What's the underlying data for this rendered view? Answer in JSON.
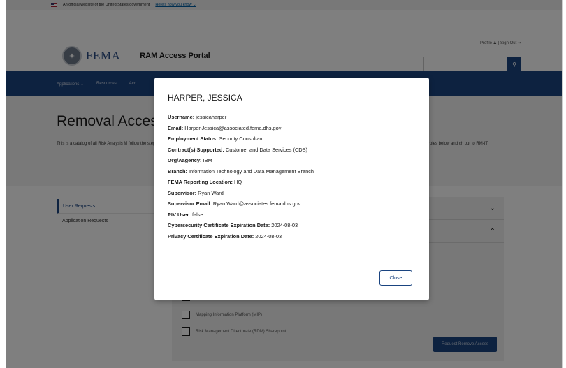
{
  "gov_banner": {
    "text": "An official website of the United States government",
    "link": "Here's how you know ⌄"
  },
  "header": {
    "logo_text": "FEMA",
    "portal_title": "RAM Access Portal",
    "profile_label": "Profile ♟ | Sign Out ⇥",
    "search_placeholder": ""
  },
  "nav": {
    "items": [
      "Applications ⌄",
      "Resources",
      "Acc"
    ]
  },
  "hero": {
    "title": "Removal Acces",
    "text_left": "This is a catalog of all Risk Analysis M follow the steps. To filter or search th Help.",
    "text_right": "roles below and ch out to RM-IT"
  },
  "sidebar": {
    "items": [
      "User Requests",
      "Application Requests"
    ]
  },
  "panel": {
    "checkboxes": [
      "",
      "Mapping Information Platform (MIP)",
      "Risk Management Directorate (RDM) Sharepoint"
    ],
    "request_button": "Request Remove Access"
  },
  "modal": {
    "title": "HARPER, JESSICA",
    "fields": [
      {
        "label": "Username:",
        "value": "jessicaharper"
      },
      {
        "label": "Email:",
        "value": "Harper.Jessica@associated.fema.dhs.gov"
      },
      {
        "label": "Employment Status:",
        "value": "Security Consultant"
      },
      {
        "label": "Contract(s) Supported:",
        "value": "Customer and Data Services (CDS)"
      },
      {
        "label": "Org/Aagency:",
        "value": "IBM"
      },
      {
        "label": "Branch:",
        "value": "Information Technology and Data Management Branch"
      },
      {
        "label": "FEMA Reporting Location:",
        "value": "HQ"
      },
      {
        "label": "Supervisor:",
        "value": "Ryan Ward"
      },
      {
        "label": "Supervisor Email:",
        "value": "Ryan.Ward@associates.fema.dhs.gov"
      },
      {
        "label": "PIV User:",
        "value": "false"
      },
      {
        "label": "Cybersecurity Certificate Expiration Date:",
        "value": "2024-08-03"
      },
      {
        "label": "Privacy Certificate Expiration Date:",
        "value": "2024-08-03"
      }
    ],
    "close_label": "Close"
  },
  "colors": {
    "primary": "#1a4480",
    "overlay": "rgba(0,0,0,0.5)"
  }
}
